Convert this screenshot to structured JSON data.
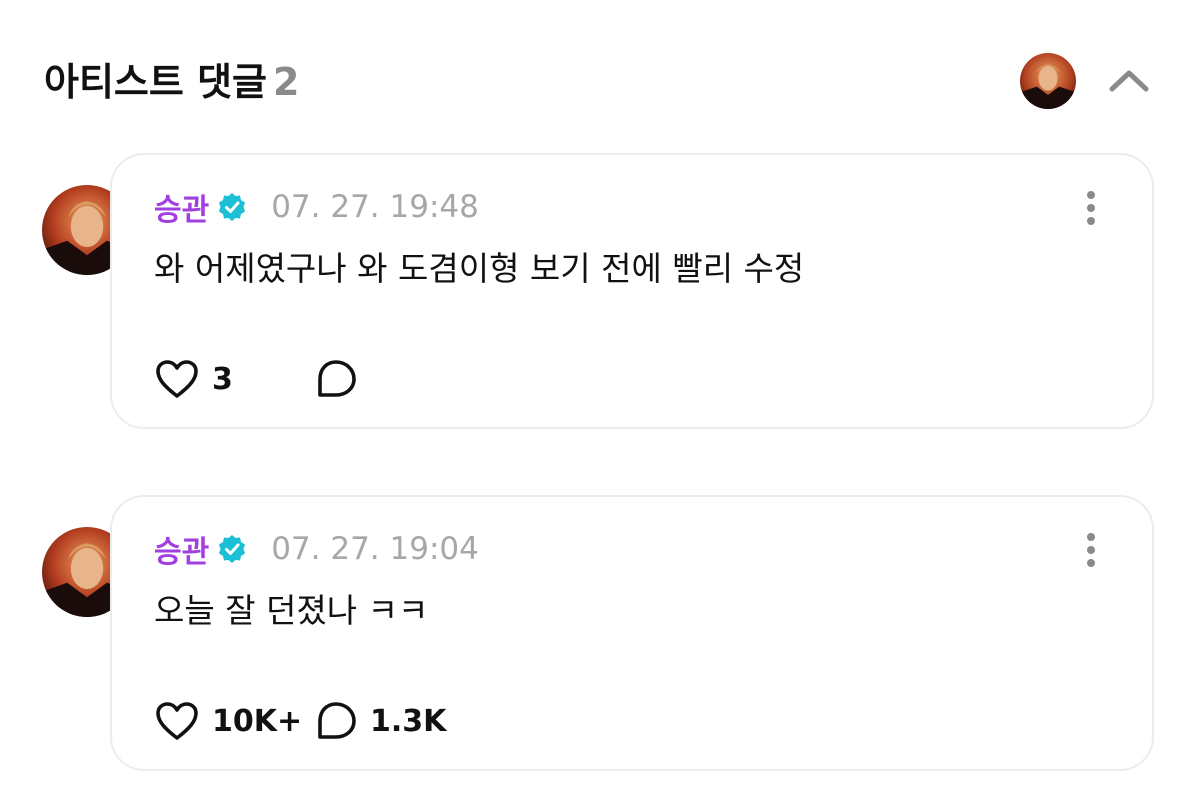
{
  "header": {
    "title": "아티스트 댓글",
    "count": "2",
    "collapse_icon": "chevron-up-icon"
  },
  "comments": [
    {
      "author": "승관",
      "verified_icon": "verified-badge-icon",
      "timestamp": "07. 27. 19:48",
      "text": "와 어제였구나 와 도겸이형 보기 전에 빨리 수정",
      "likes": "3",
      "replies": ""
    },
    {
      "author": "승관",
      "verified_icon": "verified-badge-icon",
      "timestamp": "07. 27. 19:04",
      "text": "오늘 잘 던졌나 ㅋㅋ",
      "likes": "10K+",
      "replies": "1.3K"
    }
  ],
  "colors": {
    "author": "#a23fe0",
    "verified": "#1bbfd6",
    "timestamp": "#a7a7ab",
    "card_border": "#ececee"
  }
}
